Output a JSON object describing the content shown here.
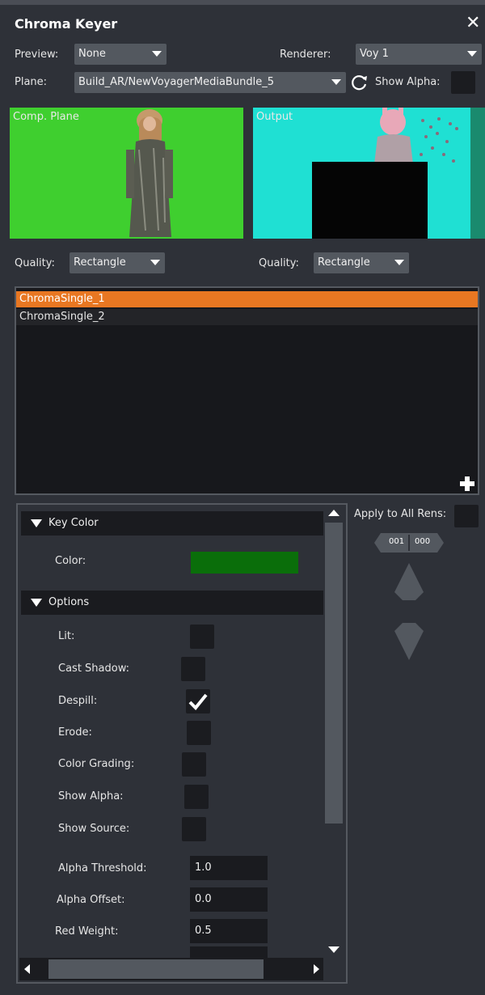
{
  "window": {
    "title": "Chroma Keyer",
    "close_icon": "close-icon"
  },
  "toolbar": {
    "preview_label": "Preview:",
    "preview_value": "None",
    "renderer_label": "Renderer:",
    "renderer_value": "Voy 1",
    "plane_label": "Plane:",
    "plane_value": "Build_AR/NewVoyagerMediaBundle_5",
    "show_alpha_label": "Show Alpha:"
  },
  "viewports": {
    "left": {
      "label": "Comp. Plane",
      "quality_label": "Quality:",
      "quality_value": "Rectangle"
    },
    "right": {
      "label": "Output",
      "quality_label": "Quality:",
      "quality_value": "Rectangle"
    }
  },
  "chroma_list": {
    "items": [
      "ChromaSingle_1",
      "ChromaSingle_2"
    ],
    "selected_index": 0
  },
  "apply_all": {
    "label": "Apply to All Rens:",
    "counter_a": "001",
    "counter_b": "000"
  },
  "properties": {
    "key_color": {
      "header": "Key Color",
      "color_label": "Color:",
      "color_value": "#0a6e0a"
    },
    "options": {
      "header": "Options",
      "checkboxes": [
        {
          "label": "Lit:",
          "checked": false
        },
        {
          "label": "Cast Shadow:",
          "checked": false
        },
        {
          "label": "Despill:",
          "checked": true
        },
        {
          "label": "Erode:",
          "checked": false
        },
        {
          "label": "Color Grading:",
          "checked": false
        },
        {
          "label": "Show Alpha:",
          "checked": false
        },
        {
          "label": "Show Source:",
          "checked": false
        }
      ],
      "numbers": [
        {
          "label": "Alpha Threshold:",
          "value": "1.0"
        },
        {
          "label": "Alpha Offset:",
          "value": "0.0"
        },
        {
          "label": "Red Weight:",
          "value": "0.5"
        }
      ]
    }
  },
  "colors": {
    "background": "#2e3138",
    "selection": "#e87722",
    "green_screen": "#3fcf2f",
    "output_bg": "#1fe0d3",
    "key_color": "#0a6e0a"
  }
}
